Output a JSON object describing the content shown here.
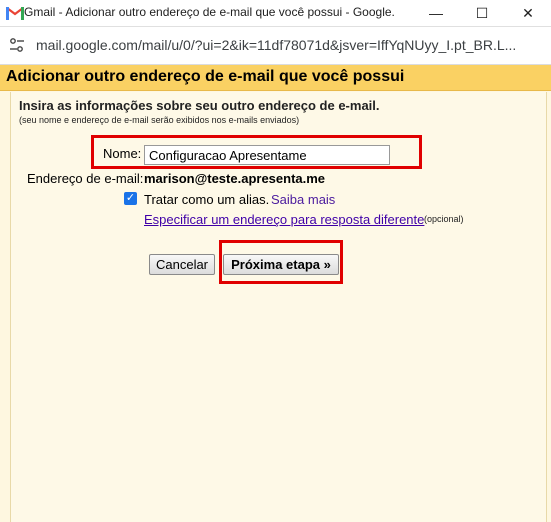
{
  "window": {
    "title": "Gmail - Adicionar outro endereço de e-mail que você possui - Google...",
    "minimize": "—",
    "maximize": "☐",
    "close": "✕"
  },
  "address_bar": {
    "url": "mail.google.com/mail/u/0/?ui=2&ik=11df78071d&jsver=IffYqNUyy_I.pt_BR.L..."
  },
  "dialog": {
    "heading": "Adicionar outro endereço de e-mail que você possui",
    "instructions": "Insira as informações sobre seu outro endereço de e-mail.",
    "note": "(seu nome e endereço de e-mail serão exibidos nos e-mails enviados)",
    "name_label": "Nome:",
    "name_value": "Configuracao Apresentame",
    "email_label": "Endereço de e-mail:",
    "email_value": "marison@teste.apresenta.me",
    "alias_checked": true,
    "alias_label": "Tratar como um alias.",
    "learn_more": "Saiba mais",
    "reply_link": "Especificar um endereço para resposta diferente",
    "optional": "(opcional)",
    "cancel_button": "Cancelar",
    "next_button": "Próxima etapa »"
  },
  "icons": [
    "gmail-icon",
    "site-settings-icon",
    "checkbox-checked-icon"
  ],
  "colors": {
    "header_bar": "#fad163",
    "panel_bg": "#fef9e7",
    "highlight": "#e00000",
    "link": "#3f00a8",
    "checkbox": "#1a73e8"
  }
}
